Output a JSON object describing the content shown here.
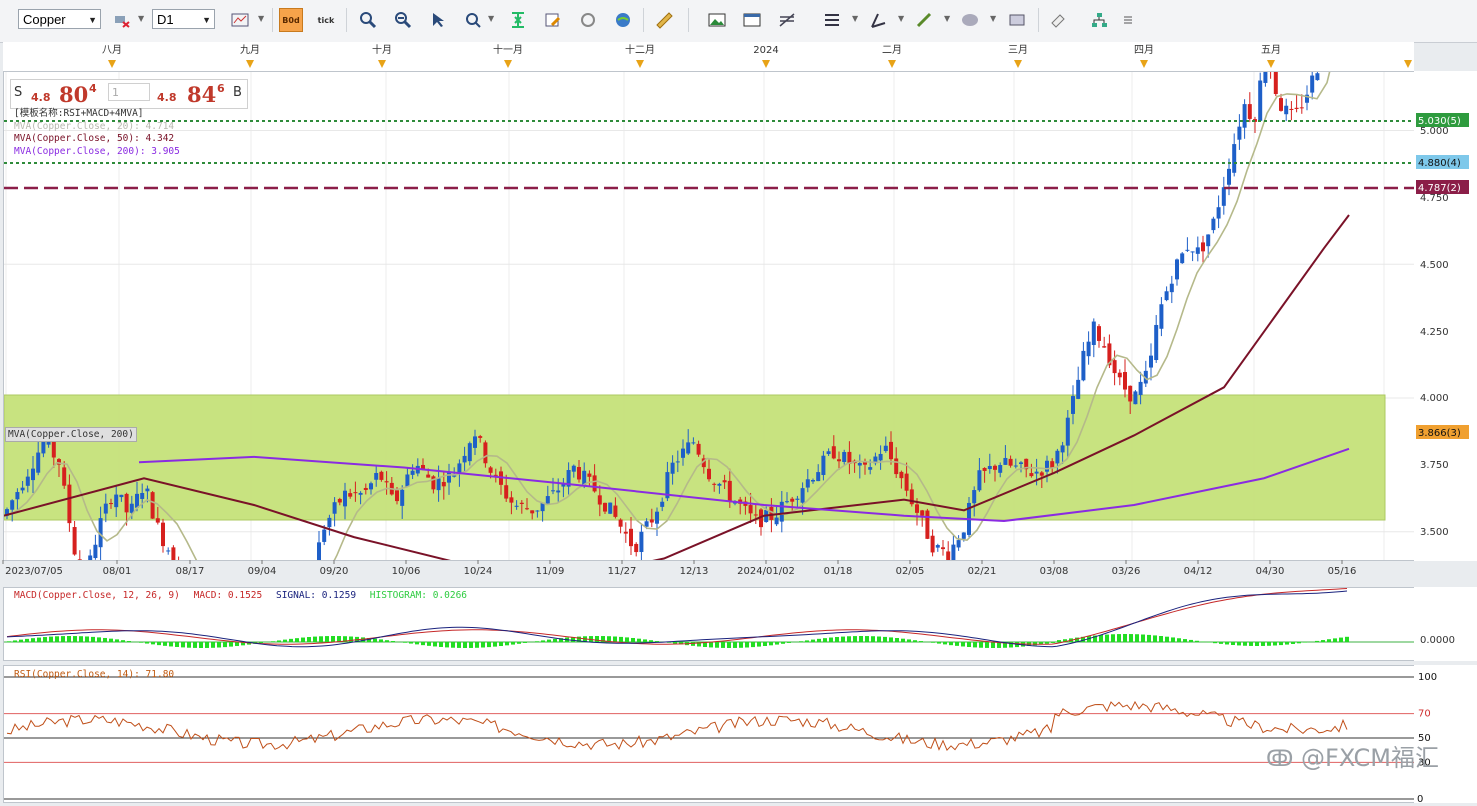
{
  "toolbar": {
    "instrument": "Copper",
    "timeframe": "D1",
    "icons": [
      "chart-type-icon",
      "candle-period-icon",
      "tick-chart-icon",
      "zoom-in-icon",
      "zoom-out-icon",
      "cursor-icon",
      "crosshair-icon",
      "indicator-icon",
      "template-icon",
      "refresh-icon",
      "globe-icon",
      "ruler-icon",
      "image-icon",
      "window-icon",
      "fibonacci-icon",
      "horizontal-lines-icon",
      "trendline-icon",
      "pen-icon",
      "ellipse-icon",
      "abc-text-icon",
      "eraser-icon",
      "tree-icon",
      "more-icon"
    ],
    "d_label": "B0d",
    "t_label": "tick"
  },
  "months_top": [
    "八月",
    "九月",
    "十月",
    "十一月",
    "十二月",
    "2024",
    "二月",
    "三月",
    "四月",
    "五月"
  ],
  "price_panel": {
    "sell_label": "S",
    "sell_price_main": "4.8",
    "sell_price_big": "80",
    "sell_price_sup": "4",
    "qty": "1",
    "buy_price_main": "4.8",
    "buy_price_big": "84",
    "buy_price_sup": "6",
    "buy_label": "B"
  },
  "legend": {
    "template": "[模板名称:RSI+MACD+4MVA]",
    "mva20": "MVA(Copper.Close, 20): 4.714",
    "mva50": "MVA(Copper.Close, 50): 4.342",
    "mva200": "MVA(Copper.Close, 200): 3.905",
    "mva_box": "MVA(Copper.Close, 200)"
  },
  "price_axis": {
    "labels": [
      "5.000",
      "4.750",
      "4.500",
      "4.250",
      "4.000",
      "3.750",
      "3.500"
    ],
    "tag_green": "5.030(5)",
    "tag_blue": "4.880(4)",
    "tag_maroon": "4.787(2)",
    "tag_orange": "3.866(3)"
  },
  "date_axis": [
    "2023/07/05",
    "08/01",
    "08/17",
    "09/04",
    "09/20",
    "10/06",
    "10/24",
    "11/09",
    "11/27",
    "12/13",
    "2024/01/02",
    "01/18",
    "02/05",
    "02/21",
    "03/08",
    "03/26",
    "04/12",
    "04/30",
    "05/16"
  ],
  "macd": {
    "title": "MACD(Copper.Close, 12, 26, 9)",
    "macd": "MACD: 0.1525",
    "signal": "SIGNAL: 0.1259",
    "hist": "HISTOGRAM: 0.0266",
    "axis_zero": "0.0000"
  },
  "rsi": {
    "title": "RSI(Copper.Close, 14): 71.80",
    "axis": [
      "100",
      "70",
      "50",
      "30",
      "0"
    ]
  },
  "watermark": "@FXCM福汇",
  "colors": {
    "up": "#1e5fc8",
    "down": "#d6201e",
    "zone": "#c6e27a",
    "mva20": "#b5b98a",
    "mva50": "#7a1228",
    "mva200": "#8a2be2",
    "green_line": "#2e8b3a",
    "maroon_line": "#8b1e48"
  }
}
